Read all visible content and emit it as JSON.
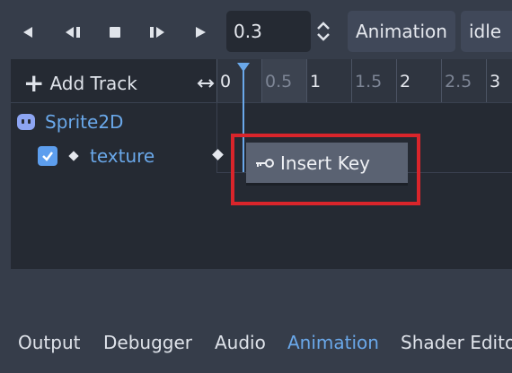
{
  "toolbar": {
    "buttons": [
      {
        "name": "play-backwards-from-end",
        "icon": "play-backwards-icon"
      },
      {
        "name": "play-backwards",
        "icon": "play-backwards-from-current-icon"
      },
      {
        "name": "stop",
        "icon": "stop-icon"
      },
      {
        "name": "play-from-current",
        "icon": "play-from-current-icon"
      },
      {
        "name": "play-from-start",
        "icon": "play-icon"
      }
    ],
    "time_value": "0.3",
    "animation_menu_label": "Animation",
    "animation_select_value": "idle"
  },
  "track_header": {
    "add_track_label": "Add Track",
    "ruler_ticks": [
      "0",
      "0.5",
      "1",
      "1.5",
      "2",
      "2.5",
      "3"
    ]
  },
  "tracks": {
    "node_name": "Sprite2D",
    "track_property": "texture",
    "track_enabled": true
  },
  "context_menu": {
    "items": [
      {
        "label": "Insert Key",
        "icon": "key-icon"
      }
    ]
  },
  "bottom_tabs": [
    "Output",
    "Debugger",
    "Audio",
    "Animation",
    "Shader Editor"
  ],
  "active_tab": "Animation",
  "colors": {
    "accent": "#6aa8ea",
    "highlight_box": "#d9252b",
    "panel_bg": "#252a33",
    "editor_bg": "#363d4a"
  }
}
